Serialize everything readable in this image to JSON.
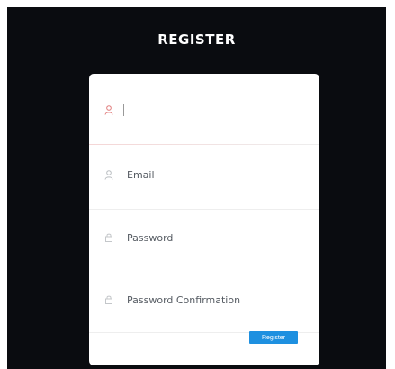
{
  "header": {
    "title": "REGISTER"
  },
  "form": {
    "name": {
      "placeholder": "",
      "icon": "user-icon",
      "icon_color": "#e07a7a"
    },
    "email": {
      "placeholder": "Email",
      "icon": "user-icon"
    },
    "password": {
      "placeholder": "Password",
      "icon": "lock-icon"
    },
    "password_confirmation": {
      "placeholder": "Password Confirmation",
      "icon": "lock-icon"
    },
    "submit_label": "Register"
  },
  "colors": {
    "background": "#0a0c10",
    "card": "#ffffff",
    "accent": "#1e90e0",
    "active_icon": "#e07a7a",
    "placeholder_text": "#555b62"
  }
}
